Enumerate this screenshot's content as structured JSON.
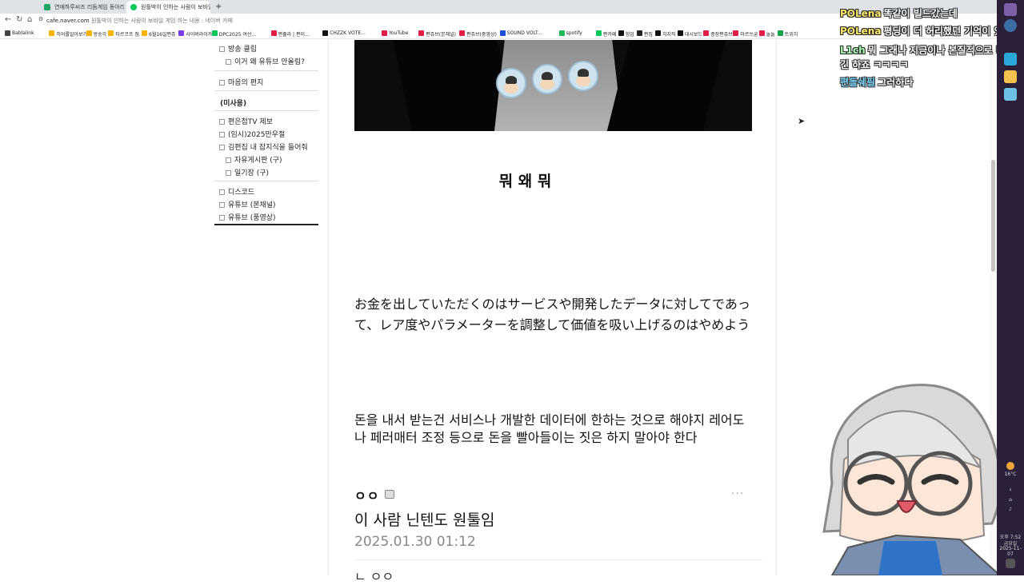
{
  "browser": {
    "tabs": [
      {
        "title": "연애하루씨즈 리듬게임 동아리"
      },
      {
        "title": "원틀박이 인하는 사람이 보바일 게임 하는 내용 : 네이버 카페"
      }
    ],
    "new_tab": "+",
    "url_domain": "cafe.naver.com",
    "url_rest": "원툴박이 인하는 사람이 보바일 게임 하는 내용 : 네이버 카페",
    "bookmarks": [
      "Bablalink",
      "히어롤알아보기",
      "방송각",
      "타르코프 점",
      "6월16일편쥬",
      "사이버라이카",
      "DPC2025 여선...",
      "편쥴라 | 편이...",
      "CHZZK VOTE...",
      "YouTube",
      "편쥬브(본채널)",
      "편쥬브(중영상)",
      "SOUND VOLT...",
      "spotify",
      "편카페",
      "힘업",
      "편집",
      "치지직",
      "대시보드",
      "중장편쥬브",
      "마르쓰굼",
      "놀놀",
      "트위치"
    ]
  },
  "sidebar": {
    "items": [
      {
        "label": "방송 클립",
        "sub": false
      },
      {
        "label": "이거 왜 유튜브 안올림?",
        "sub": true
      },
      {
        "label": "마음의 편지",
        "sub": false
      },
      {
        "label": "(미사용)",
        "sub": false,
        "bold": true
      },
      {
        "label": "편은첩TV 제보",
        "sub": false
      },
      {
        "label": "(임시)2025만우절",
        "sub": false
      },
      {
        "label": "김편집 내 잡지식을 들어줘",
        "sub": false
      },
      {
        "label": "자유게시판 (구)",
        "sub": true
      },
      {
        "label": "일기장 (구)",
        "sub": true
      },
      {
        "label": "디스코드",
        "sub": false
      },
      {
        "label": "유튜브 (본채널)",
        "sub": false
      },
      {
        "label": "유튜브 (풍영상)",
        "sub": false
      }
    ]
  },
  "post": {
    "headline": "뭐 왜 뭐",
    "jp_text": "お金を出していただくのはサービスや開発したデータに対してであって、レア度やパラメーターを調整して価値を吸い上げるのはやめよう",
    "kr_text": "돈을 내서 받는건 서비스나 개발한 데이터에 한하는 것으로 해야지 레어도나 페러매터 조정 등으로 돈을 빨아들이는 짓은 하지 말아야 한다"
  },
  "comment": {
    "author": "ㅇㅇ",
    "more": "···",
    "text": "이 사람 닌텐도 원툴임",
    "date": "2025.01.30 01:12",
    "next_author": "ㄴ ㅇㅇ"
  },
  "chat": [
    {
      "nick": "POLena",
      "msg": "똑같이 빌드갔는데",
      "nick_color": "#ffe96a"
    },
    {
      "nick": "POLena",
      "msg": "평딩이 더 허리했던 기억이 있음",
      "nick_color": "#ffe96a"
    },
    {
      "nick": "L1ch",
      "msg": "뭐 그래나 지금이나 본질적으로 비슷하",
      "nick_color": "#a6ffb0"
    },
    {
      "nick": "",
      "msg": "긴 하죠 ㅋㅋㅋㅋ",
      "nick_color": "#a6ffb0"
    },
    {
      "nick": "편돌쉐필",
      "msg": "그러하다",
      "nick_color": "#7fd7ff"
    }
  ],
  "taskbar": {
    "weather": "16°C",
    "time": "오후 7:52",
    "day": "금요일",
    "date": "2025-11-07"
  },
  "colors": {
    "taskbar_bg": "#2b1f3a",
    "naver_green": "#03c75a",
    "avatar_hair": "#d8d8d8",
    "avatar_jacket": "#7a8fb0"
  }
}
